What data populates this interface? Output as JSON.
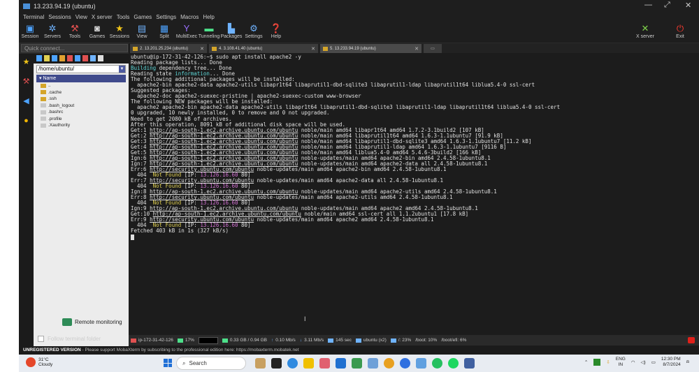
{
  "window": {
    "title": "13.233.94.19 (ubuntu)",
    "controls": [
      "—",
      "⤢",
      "✕"
    ]
  },
  "menu": [
    "Terminal",
    "Sessions",
    "View",
    "X server",
    "Tools",
    "Games",
    "Settings",
    "Macros",
    "Help"
  ],
  "toolbar": {
    "left": [
      "Session",
      "Servers",
      "Tools",
      "Games",
      "Sessions",
      "View",
      "Split",
      "MultiExec",
      "Tunneling",
      "Packages",
      "Settings",
      "Help"
    ],
    "right": [
      "X server",
      "Exit"
    ]
  },
  "sidebar": {
    "quick_connect_placeholder": "Quick connect...",
    "path": "/home/ubuntu/",
    "column_header": "Name",
    "files": [
      "..",
      ".cache",
      ".ssh",
      ".bash_logout",
      ".bashrc",
      ".profile",
      ".Xauthority"
    ],
    "remote_monitoring": "Remote monitoring",
    "follow_terminal_folder": "Follow terminal folder"
  },
  "tabs": [
    {
      "label": "2. 13.201.25.234 (ubuntu)",
      "color": "#d4a52a"
    },
    {
      "label": "4. 3.108.41.40 (ubuntu)",
      "color": "#d4a52a"
    },
    {
      "label": "5. 13.233.94.19 (ubuntu)",
      "color": "#d4a52a"
    }
  ],
  "terminal": {
    "lines": [
      [
        {
          "t": "ubuntu@ip-172-31-42-126:~$ sudo apt install apache2 -y"
        }
      ],
      [
        {
          "t": "Reading package lists... Done"
        }
      ],
      [
        {
          "t": "Building",
          "c": "cyan"
        },
        {
          "t": " dependency tree... Done"
        }
      ],
      [
        {
          "t": "Reading state "
        },
        {
          "t": "information",
          "c": "cyan"
        },
        {
          "t": "... Done"
        }
      ],
      [
        {
          "t": "The following additional packages will be installed:"
        }
      ],
      [
        {
          "t": "  apache2-bin apache2-data apache2-utils libapr1t64 libaprutil1-dbd-sqlite3 libaprutil1-ldap libaprutil1t64 liblua5.4-0 ssl-cert"
        }
      ],
      [
        {
          "t": "Suggested packages:"
        }
      ],
      [
        {
          "t": "  apache2-doc apache2-suexec-pristine | apache2-suexec-custom www-browser"
        }
      ],
      [
        {
          "t": "The following NEW packages will be installed:"
        }
      ],
      [
        {
          "t": "  apache2 apache2-bin apache2-data apache2-utils libapr1t64 libaprutil1-dbd-sqlite3 libaprutil1-ldap libaprutil1t64 liblua5.4-0 ssl-cert"
        }
      ],
      [
        {
          "t": "0 upgraded, 10 newly installed, 0 to remove and 0 not upgraded."
        }
      ],
      [
        {
          "t": "Need to get 2080 kB of archives."
        }
      ],
      [
        {
          "t": "After this operation, 8091 kB of additional disk space will be used."
        }
      ],
      [
        {
          "t": "Get:1 "
        },
        {
          "t": "http://ap-south-1.ec2.archive.ubuntu.com/ubuntu",
          "c": "url"
        },
        {
          "t": " noble/main amd64 libapr1t64 amd64 1.7.2-3.1build2 [107 kB]"
        }
      ],
      [
        {
          "t": "Get:2 "
        },
        {
          "t": "http://ap-south-1.ec2.archive.ubuntu.com/ubuntu",
          "c": "url"
        },
        {
          "t": " noble/main amd64 libaprutil1t64 amd64 1.6.3-1.1ubuntu7 [91.9 kB]"
        }
      ],
      [
        {
          "t": "Get:3 "
        },
        {
          "t": "http://ap-south-1.ec2.archive.ubuntu.com/ubuntu",
          "c": "url"
        },
        {
          "t": " noble/main amd64 libaprutil1-dbd-sqlite3 amd64 1.6.3-1.1ubuntu7 [11.2 kB]"
        }
      ],
      [
        {
          "t": "Get:4 "
        },
        {
          "t": "http://ap-south-1.ec2.archive.ubuntu.com/ubuntu",
          "c": "url"
        },
        {
          "t": " noble/main amd64 libaprutil1-ldap amd64 1.6.3-1.1ubuntu7 [9116 B]"
        }
      ],
      [
        {
          "t": "Get:5 "
        },
        {
          "t": "http://ap-south-1.ec2.archive.ubuntu.com/ubuntu",
          "c": "url"
        },
        {
          "t": " noble/main amd64 liblua5.4-0 amd64 5.4.6-3build2 [166 kB]"
        }
      ],
      [
        {
          "t": "Ign:6 "
        },
        {
          "t": "http://ap-south-1.ec2.archive.ubuntu.com/ubuntu",
          "c": "url"
        },
        {
          "t": " noble-updates/main amd64 apache2-bin amd64 2.4.58-1ubuntu8.1"
        }
      ],
      [
        {
          "t": "Ign:7 "
        },
        {
          "t": "http://ap-south-1.ec2.archive.ubuntu.com/ubuntu",
          "c": "url"
        },
        {
          "t": " noble-updates/main amd64 apache2-data all 2.4.58-1ubuntu8.1"
        }
      ],
      [
        {
          "t": "Err:6 "
        },
        {
          "t": "http://security.ubuntu.com/ubuntu",
          "c": "url"
        },
        {
          "t": " noble-updates/main amd64 apache2-bin amd64 2.4.58-1ubuntu8.1"
        }
      ],
      [
        {
          "t": "  404  "
        },
        {
          "t": "Not Found",
          "c": "yel"
        },
        {
          "t": " [IP: "
        },
        {
          "t": "13.126.16.60",
          "c": "mag"
        },
        {
          "t": " 80]"
        }
      ],
      [
        {
          "t": "Err:7 "
        },
        {
          "t": "http://security.ubuntu.com/ubuntu",
          "c": "url"
        },
        {
          "t": " noble-updates/main amd64 apache2-data all 2.4.58-1ubuntu8.1"
        }
      ],
      [
        {
          "t": "  404  "
        },
        {
          "t": "Not Found",
          "c": "yel"
        },
        {
          "t": " [IP: "
        },
        {
          "t": "13.126.16.60",
          "c": "mag"
        },
        {
          "t": " 80]"
        }
      ],
      [
        {
          "t": "Ign:8 "
        },
        {
          "t": "http://ap-south-1.ec2.archive.ubuntu.com/ubuntu",
          "c": "url"
        },
        {
          "t": " noble-updates/main amd64 apache2-utils amd64 2.4.58-1ubuntu8.1"
        }
      ],
      [
        {
          "t": "Err:8 "
        },
        {
          "t": "http://security.ubuntu.com/ubuntu",
          "c": "url"
        },
        {
          "t": " noble-updates/main amd64 apache2-utils amd64 2.4.58-1ubuntu8.1"
        }
      ],
      [
        {
          "t": "  404  "
        },
        {
          "t": "Not Found",
          "c": "yel"
        },
        {
          "t": " [IP: "
        },
        {
          "t": "13.126.16.60",
          "c": "mag"
        },
        {
          "t": " 80]"
        }
      ],
      [
        {
          "t": "Ign:9 "
        },
        {
          "t": "http://ap-south-1.ec2.archive.ubuntu.com/ubuntu",
          "c": "url"
        },
        {
          "t": " noble-updates/main amd64 apache2 amd64 2.4.58-1ubuntu8.1"
        }
      ],
      [
        {
          "t": "Get:10 "
        },
        {
          "t": "http://ap-south-1.ec2.archive.ubuntu.com/ubuntu",
          "c": "url"
        },
        {
          "t": " noble/main amd64 ssl-cert all 1.1.2ubuntu1 [17.8 kB]"
        }
      ],
      [
        {
          "t": "Err:9 "
        },
        {
          "t": "http://security.ubuntu.com/ubuntu",
          "c": "url"
        },
        {
          "t": " noble-updates/main amd64 apache2 amd64 2.4.58-1ubuntu8.1"
        }
      ],
      [
        {
          "t": "  404  "
        },
        {
          "t": "Not Found",
          "c": "yel"
        },
        {
          "t": " [IP: "
        },
        {
          "t": "13.126.16.60",
          "c": "mag"
        },
        {
          "t": " 80]"
        }
      ],
      [
        {
          "t": "Fetched 403 kB in 1s (327 kB/s)"
        }
      ]
    ]
  },
  "status": {
    "host": "ip-172-31-42-126",
    "cpu": "17%",
    "mem": "0.33 GB / 0.94 GB",
    "up": "0.10 Mb/s",
    "down": "3.11 Mb/s",
    "uptime": "145 sec",
    "users": "ubuntu (x2)",
    "disk_root": "/: 23%",
    "disk_boot": "/boot: 10%",
    "disk_efi": "/boot/efi: 6%"
  },
  "unregistered": {
    "label": "UNREGISTERED VERSION",
    "text": " -  Please support MobaXterm by subscribing to the professional edition here:  https://mobaxterm.mobatek.net"
  },
  "taskbar": {
    "temp": "31°C",
    "weather": "Cloudy",
    "search": "Search",
    "lang": "ENG",
    "region": "IN",
    "time": "12:30 PM",
    "date": "8/7/2024"
  }
}
